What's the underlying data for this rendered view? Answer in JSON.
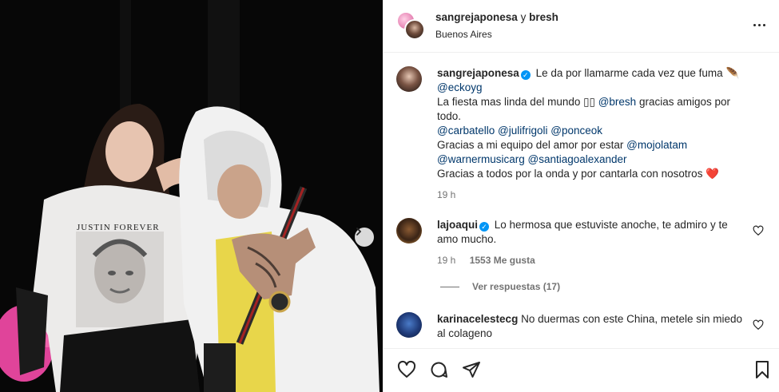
{
  "header": {
    "user1": "sangrejaponesa",
    "joiner": "y",
    "user2": "bresh",
    "location": "Buenos Aires"
  },
  "caption": {
    "username": "sangrejaponesa",
    "line1_text": "Le da por llamarme cada vez que fuma",
    "line1_emoji": "🪶",
    "mention_eckoyg": "@eckoyg",
    "line3_a": "La fiesta mas linda del mundo",
    "line3_mention": "@bresh",
    "line3_b": "gracias amigos por todo.",
    "m_carbatello": "@carbatello",
    "m_julifrigoli": "@julifrigoli",
    "m_ponceok": "@ponceok",
    "line5_a": "Gracias a mi equipo del amor por estar",
    "m_mojolatam": "@mojolatam",
    "m_warnermusicarg": "@warnermusicarg",
    "m_santiagoalexander": "@santiagoalexander",
    "line7": "Gracias a todos por la onda y por cantarla con nosotros",
    "line7_emoji": "❤️",
    "time": "19 h"
  },
  "comments": [
    {
      "username": "lajoaqui",
      "text": "Lo hermosa que estuviste anoche, te admiro y te amo mucho.",
      "time": "19 h",
      "likes": "1553 Me gusta",
      "replies": "Ver respuestas (17)"
    },
    {
      "username": "karinacelestecg",
      "text": "No duermas con este China, metele sin miedo al colageno"
    }
  ],
  "photo": {
    "shirt_text": "JUSTIN FOREVER"
  },
  "icons": [
    "heart-icon",
    "comment-icon",
    "share-icon",
    "save-icon",
    "more-icon",
    "chevron-right-icon",
    "verified-icon"
  ],
  "colors": {
    "mention": "#00376b",
    "verified": "#0095f6",
    "muted": "#737373",
    "heart_red": "#ed4956"
  }
}
